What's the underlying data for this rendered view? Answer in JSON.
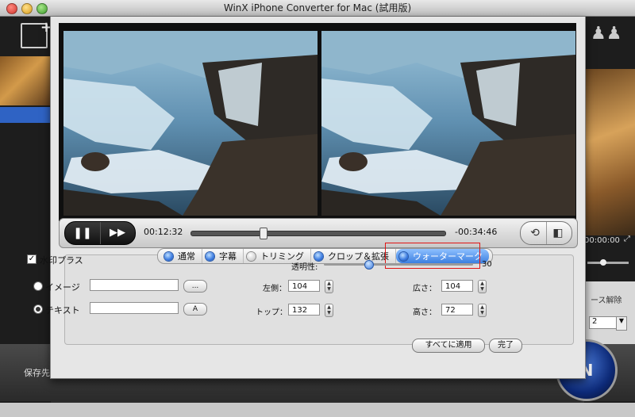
{
  "window": {
    "title": "WinX iPhone Converter for Mac (試用版)"
  },
  "background": {
    "time": "00:00:00",
    "interlace_label": "ース解除",
    "number_value": "2",
    "save_label": "保存先フォルダ:",
    "run_label": "N"
  },
  "player": {
    "current_time": "00:12:32",
    "remaining_time": "-00:34:46",
    "seek_fraction": 0.28
  },
  "tabs": [
    {
      "label": "通常",
      "selected": false
    },
    {
      "label": "字幕",
      "selected": false
    },
    {
      "label": "トリミング",
      "selected": false
    },
    {
      "label": "クロップ＆拡張",
      "selected": false
    },
    {
      "label": "ウォーターマーク",
      "selected": true
    }
  ],
  "watermark": {
    "enable_label": "水印プラス",
    "enabled": true,
    "opacity_label": "透明性:",
    "opacity_value": "30",
    "opacity_fraction": 0.3,
    "image_label": "イメージ",
    "image_value": "",
    "browse_label": "...",
    "text_label": "テキスト",
    "text_value": "",
    "font_label": "A",
    "left_label": "左側：",
    "left_value": "104",
    "top_label": "トップ：",
    "top_value": "132",
    "width_label": "広さ：",
    "width_value": "104",
    "height_label": "高さ：",
    "height_value": "72"
  },
  "buttons": {
    "apply_all": "すべてに適用",
    "done": "完了"
  },
  "colors": {
    "accent": "#3c7fe0",
    "highlight": "#e01515"
  }
}
